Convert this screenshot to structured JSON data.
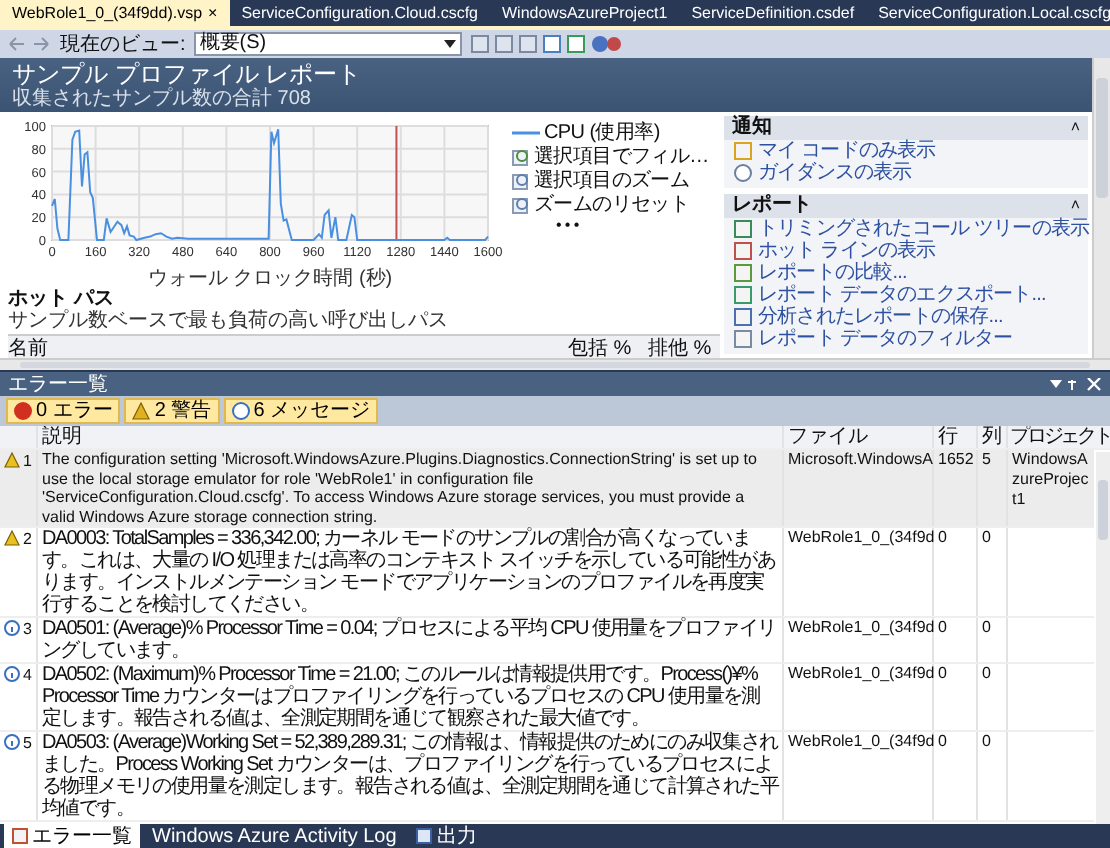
{
  "document_tabs": [
    {
      "label": "WebRole1_0_(34f9dd).vsp",
      "selected": true,
      "close": "×"
    },
    {
      "label": "ServiceConfiguration.Cloud.cscfg",
      "selected": false
    },
    {
      "label": "WindowsAzureProject1",
      "selected": false
    },
    {
      "label": "ServiceDefinition.csdef",
      "selected": false
    },
    {
      "label": "ServiceConfiguration.Local.cscfg",
      "selected": false
    }
  ],
  "toolbar": {
    "view_label": "現在のビュー:",
    "view_value": "概要(S)"
  },
  "report": {
    "title": "サンプル プロファイル レポート",
    "subtitle": "収集されたサンプル数の合計 708",
    "chart": {
      "commands": [
        {
          "label": "選択項目でフィル…",
          "kind": "filter"
        },
        {
          "label": "選択項目のズーム",
          "kind": "zoom"
        },
        {
          "label": "ズームのリセット",
          "kind": "reset"
        }
      ],
      "more": "• • •",
      "chart_data": {
        "type": "line",
        "xlabel": "ウォール クロック時間 (秒)",
        "grid": true,
        "xlim": [
          0,
          1600
        ],
        "ylim": [
          0,
          100
        ],
        "xticks": [
          0,
          160,
          320,
          480,
          640,
          800,
          960,
          1120,
          1280,
          1440,
          1600
        ],
        "yticks": [
          0,
          20,
          40,
          60,
          80,
          100
        ],
        "x": [
          0,
          10,
          20,
          30,
          60,
          75,
          85,
          100,
          110,
          120,
          130,
          140,
          150,
          165,
          190,
          200,
          215,
          240,
          255,
          265,
          275,
          285,
          300,
          310,
          340,
          360,
          380,
          400,
          420,
          440,
          460,
          500,
          560,
          640,
          700,
          760,
          795,
          805,
          815,
          830,
          840,
          850,
          860,
          880,
          960,
          980,
          990,
          1000,
          1015,
          1025,
          1040,
          1050,
          1080,
          1100,
          1110,
          1120,
          1440,
          1450,
          1460,
          1590,
          1600
        ],
        "series": [
          {
            "name": "CPU (使用率)",
            "color": "#4a90e2",
            "values": [
              30,
              36,
              10,
              0,
              0,
              88,
              95,
              96,
              47,
              75,
              77,
              42,
              37,
              0,
              0,
              19,
              7,
              16,
              13,
              6,
              12,
              4,
              3,
              0,
              2,
              3,
              5,
              6,
              3,
              1,
              2,
              1,
              1,
              1,
              1,
              1,
              1,
              95,
              85,
              97,
              32,
              17,
              18,
              0,
              0,
              5,
              2,
              22,
              26,
              2,
              20,
              0,
              0,
              22,
              20,
              0,
              0,
              2,
              0,
              0,
              3
            ]
          }
        ],
        "ref_lines": [
          {
            "axis": "x",
            "value": 1264,
            "color": "#c0504d"
          }
        ]
      }
    },
    "hot_path": {
      "title": "ホット パス",
      "subtitle": "サンプル数ベースで最も負荷の高い呼び出しパス",
      "columns": [
        "名前",
        "包括 %",
        "排他 %"
      ]
    },
    "sections": [
      {
        "title": "通知",
        "collapse": "˄",
        "items": [
          {
            "label": "マイ コードのみ表示",
            "kind": "code"
          },
          {
            "label": "ガイダンスの表示",
            "kind": "info"
          }
        ]
      },
      {
        "title": "レポート",
        "collapse": "˄",
        "items": [
          {
            "label": "トリミングされたコール ツリーの表示",
            "kind": "tree"
          },
          {
            "label": "ホット ラインの表示",
            "kind": "lines"
          },
          {
            "label": "レポートの比較...",
            "kind": "compare"
          },
          {
            "label": "レポート データのエクスポート...",
            "kind": "export"
          },
          {
            "label": "分析されたレポートの保存...",
            "kind": "save"
          },
          {
            "label": "レポート データのフィルター",
            "kind": "filter"
          }
        ]
      }
    ]
  },
  "error_list": {
    "title": "エラー一覧",
    "filters": [
      {
        "label": "0 エラー",
        "kind": "error",
        "selected": true
      },
      {
        "label": "2 警告",
        "kind": "warning",
        "selected": true
      },
      {
        "label": "6 メッセージ",
        "kind": "info",
        "selected": true
      }
    ],
    "columns": [
      "説明",
      "ファイル",
      "行",
      "列",
      "プロジェクト"
    ],
    "rows": [
      {
        "kind": "warning",
        "selected": true,
        "number": "1",
        "description": "The configuration setting 'Microsoft.WindowsAzure.Plugins.Diagnostics.ConnectionString' is set up to use the local storage emulator for role 'WebRole1' in configuration file 'ServiceConfiguration.Cloud.cscfg'. To access Windows Azure storage services, you must provide a valid Windows Azure storage connection string.",
        "file": "Microsoft.WindowsA",
        "line": "1652",
        "column": "5",
        "project": "WindowsAzureProject1"
      },
      {
        "kind": "warning",
        "selected": false,
        "number": "2",
        "description": "DA0003: TotalSamples = 336,342.00; カーネル モードのサンプルの割合が高くなっています。これは、大量の I/O 処理または高率のコンテキスト スイッチを示している可能性があります。インストルメンテーション モードでアプリケーションのプロファイルを再度実行することを検討してください。",
        "file": "WebRole1_0_(34f9d",
        "line": "0",
        "column": "0"
      },
      {
        "kind": "info",
        "selected": false,
        "number": "3",
        "description": "DA0501: (Average)% Processor Time = 0.04; プロセスによる平均 CPU 使用量をプロファイリングしています。",
        "file": "WebRole1_0_(34f9d",
        "line": "0",
        "column": "0"
      },
      {
        "kind": "info",
        "selected": false,
        "number": "4",
        "description": "DA0502: (Maximum)% Processor Time = 21.00; このルールは情報提供用です。Process()¥% Processor Time カウンターはプロファイリングを行っているプロセスの CPU 使用量を測定します。報告される値は、全測定期間を通じて観察された最大値です。",
        "file": "WebRole1_0_(34f9d",
        "line": "0",
        "column": "0"
      },
      {
        "kind": "info",
        "selected": false,
        "number": "5",
        "description": "DA0503: (Average)Working Set = 52,389,289.31; この情報は、情報提供のためにのみ収集されました。Process Working Set カウンターは、プロファイリングを行っているプロセスによる物理メモリの使用量を測定します。報告される値は、全測定期間を通じて計算された平均値です。",
        "file": "WebRole1_0_(34f9d",
        "line": "0",
        "column": "0"
      }
    ]
  },
  "bottom_tabs": [
    {
      "label": "エラー一覧",
      "kind": "errors",
      "selected": true
    },
    {
      "label": "Windows Azure Activity Log",
      "kind": "plain",
      "selected": false
    },
    {
      "label": "出力",
      "kind": "output",
      "selected": false
    }
  ]
}
